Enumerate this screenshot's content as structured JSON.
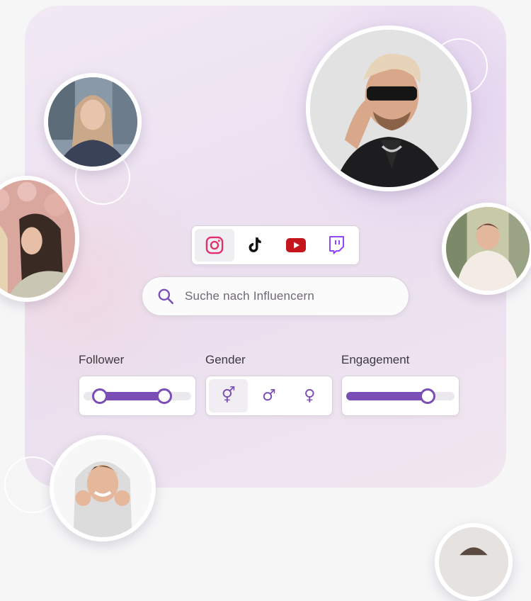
{
  "platforms": [
    {
      "name": "instagram-icon",
      "active": true,
      "color": "#e1306c"
    },
    {
      "name": "tiktok-icon",
      "active": false,
      "color": "#111111"
    },
    {
      "name": "youtube-icon",
      "active": false,
      "color": "#c4151c"
    },
    {
      "name": "twitch-icon",
      "active": false,
      "color": "#9146ff"
    }
  ],
  "search": {
    "placeholder": "Suche nach Influencern",
    "icon": "search-icon"
  },
  "filters": {
    "follower": {
      "label": "Follower",
      "range_min": 0.15,
      "range_max": 0.75
    },
    "gender": {
      "label": "Gender",
      "options": [
        "⚥",
        "♂",
        "♀"
      ],
      "selected": 0
    },
    "engagement": {
      "label": "Engagement",
      "value": 0.75
    }
  },
  "colors": {
    "accent": "#7b4eb5",
    "card_bg": "#ede3f1",
    "page_bg": "#f6f6f7"
  }
}
